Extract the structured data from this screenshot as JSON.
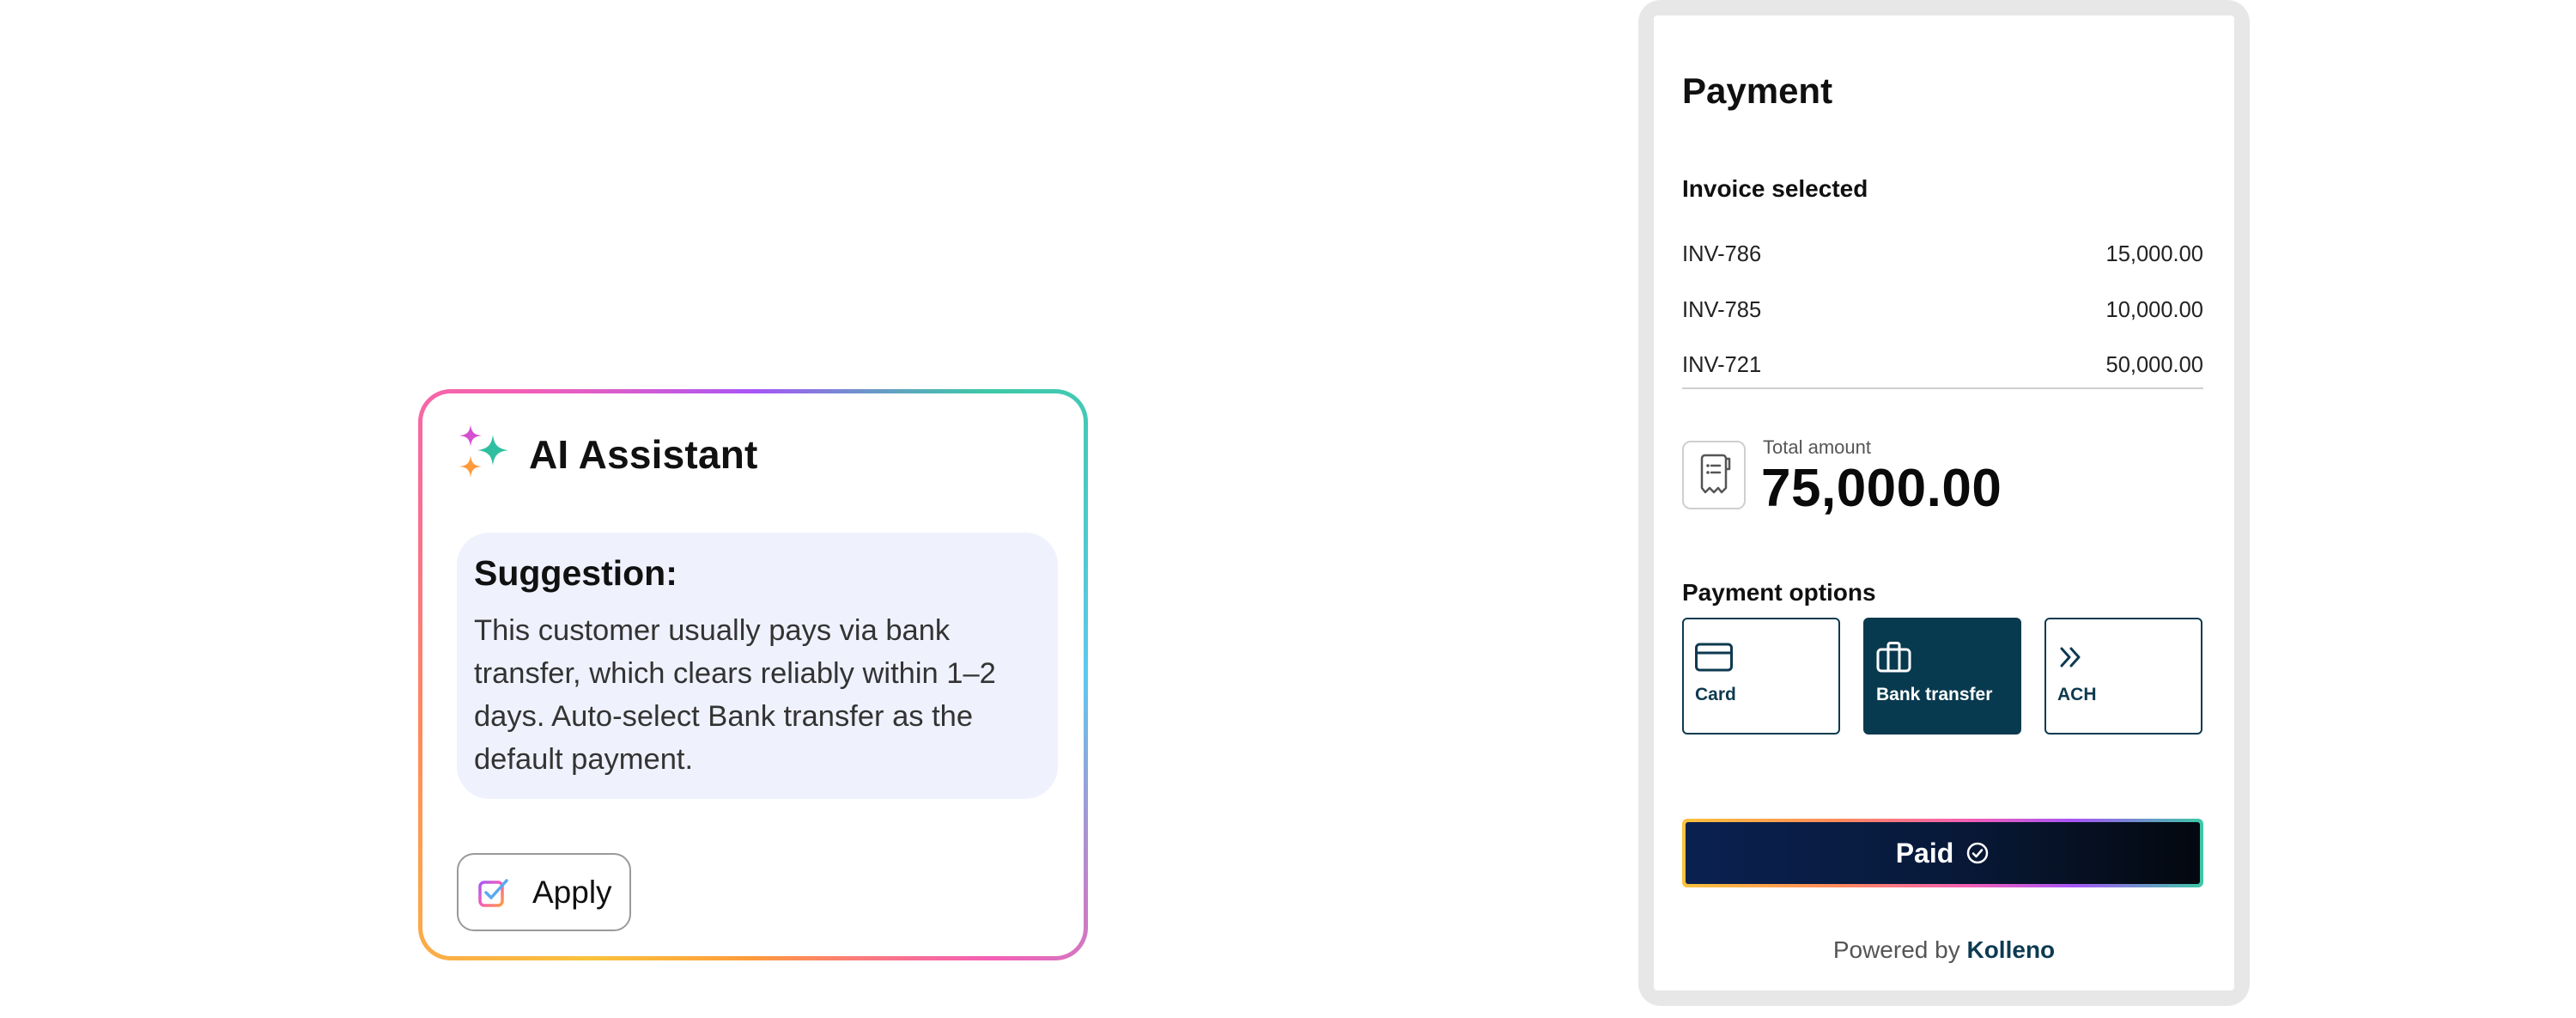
{
  "ai_assistant": {
    "title": "AI Assistant",
    "suggestion_label": "Suggestion:",
    "suggestion_text": "This customer usually pays via bank transfer, which clears reliably within 1–2 days. Auto-select Bank transfer as the default payment.",
    "apply_label": "Apply",
    "icons": [
      "sparkles-icon",
      "checklist-icon"
    ]
  },
  "payment": {
    "title": "Payment",
    "invoice_section": "Invoice selected",
    "invoices": [
      {
        "id": "INV-786",
        "amount": "15,000.00"
      },
      {
        "id": "INV-785",
        "amount": "10,000.00"
      },
      {
        "id": "INV-721",
        "amount": "50,000.00"
      }
    ],
    "total_label": "Total amount",
    "total_value": "75,000.00",
    "options_section": "Payment options",
    "options": [
      {
        "label": "Card",
        "icon": "credit-card-icon",
        "selected": false
      },
      {
        "label": "Bank transfer",
        "icon": "briefcase-icon",
        "selected": true
      },
      {
        "label": "ACH",
        "icon": "double-chevron-right-icon",
        "selected": false
      }
    ],
    "paid_label": "Paid",
    "powered_prefix": "Powered by",
    "powered_brand": "Kolleno"
  },
  "colors": {
    "accent_dark": "#083a4f",
    "suggestion_bg": "#eff1fd",
    "panel_frame": "#e7e7e7"
  }
}
